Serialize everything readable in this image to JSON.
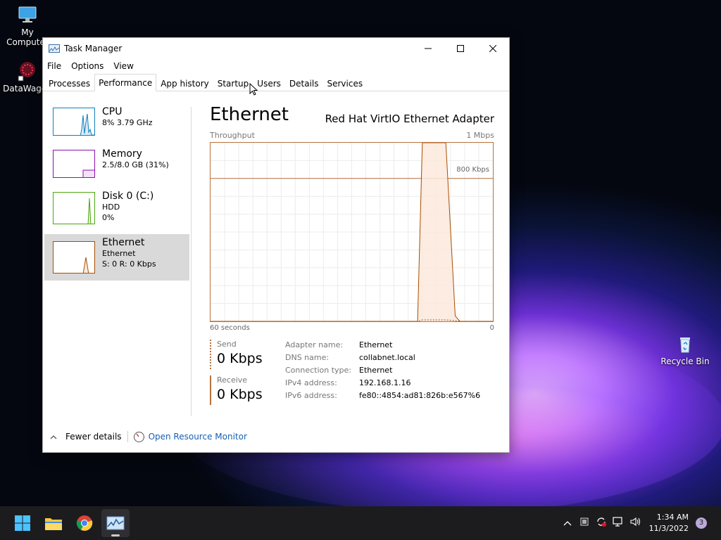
{
  "desktop": {
    "icons": [
      {
        "label": "My Computer"
      },
      {
        "label": "DataWagon"
      },
      {
        "label": "Recycle Bin"
      }
    ]
  },
  "window": {
    "title": "Task Manager",
    "menu": [
      "File",
      "Options",
      "View"
    ],
    "tabs": [
      "Processes",
      "Performance",
      "App history",
      "Startup",
      "Users",
      "Details",
      "Services"
    ],
    "active_tab": "Performance"
  },
  "sidebar": {
    "items": [
      {
        "title": "CPU",
        "sub1": "8%  3.79 GHz",
        "sub2": "",
        "color": "#117dbb"
      },
      {
        "title": "Memory",
        "sub1": "2.5/8.0 GB (31%)",
        "sub2": "",
        "color": "#8b12ae"
      },
      {
        "title": "Disk 0 (C:)",
        "sub1": "HDD",
        "sub2": "0%",
        "color": "#4da60c"
      },
      {
        "title": "Ethernet",
        "sub1": "Ethernet",
        "sub2": "S: 0  R: 0 Kbps",
        "color": "#a74f01"
      }
    ],
    "active_index": 3
  },
  "main": {
    "title": "Ethernet",
    "adapter": "Red Hat VirtIO Ethernet Adapter",
    "throughput_label": "Throughput",
    "max_label": "1 Mbps",
    "gridline_label": "800 Kbps",
    "x_left": "60 seconds",
    "x_right": "0",
    "send_label": "Send",
    "send_value": "0 Kbps",
    "receive_label": "Receive",
    "receive_value": "0 Kbps",
    "details": [
      {
        "k": "Adapter name:",
        "v": "Ethernet"
      },
      {
        "k": "DNS name:",
        "v": "collabnet.local"
      },
      {
        "k": "Connection type:",
        "v": "Ethernet"
      },
      {
        "k": "IPv4 address:",
        "v": "192.168.1.16"
      },
      {
        "k": "IPv6 address:",
        "v": "fe80::4854:ad81:826b:e567%6"
      }
    ]
  },
  "chart_data": {
    "type": "area",
    "title": "Throughput",
    "xlabel": "",
    "ylabel": "",
    "x_range_seconds": [
      60,
      0
    ],
    "ylim_kbps": [
      0,
      1000
    ],
    "gridline_kbps": 800,
    "series": [
      {
        "name": "Receive",
        "x_seconds_ago": [
          60,
          16,
          15,
          10,
          8,
          7,
          0
        ],
        "values_kbps": [
          0,
          0,
          1000,
          1000,
          30,
          0,
          0
        ]
      },
      {
        "name": "Send",
        "x_seconds_ago": [
          60,
          16,
          15,
          10,
          8,
          7,
          0
        ],
        "values_kbps": [
          0,
          0,
          8,
          8,
          4,
          0,
          0
        ]
      }
    ]
  },
  "footer": {
    "fewer_details": "Fewer details",
    "open_resource_monitor": "Open Resource Monitor"
  },
  "taskbar": {
    "time": "1:34 AM",
    "date": "11/3/2022",
    "notification_count": "3"
  }
}
